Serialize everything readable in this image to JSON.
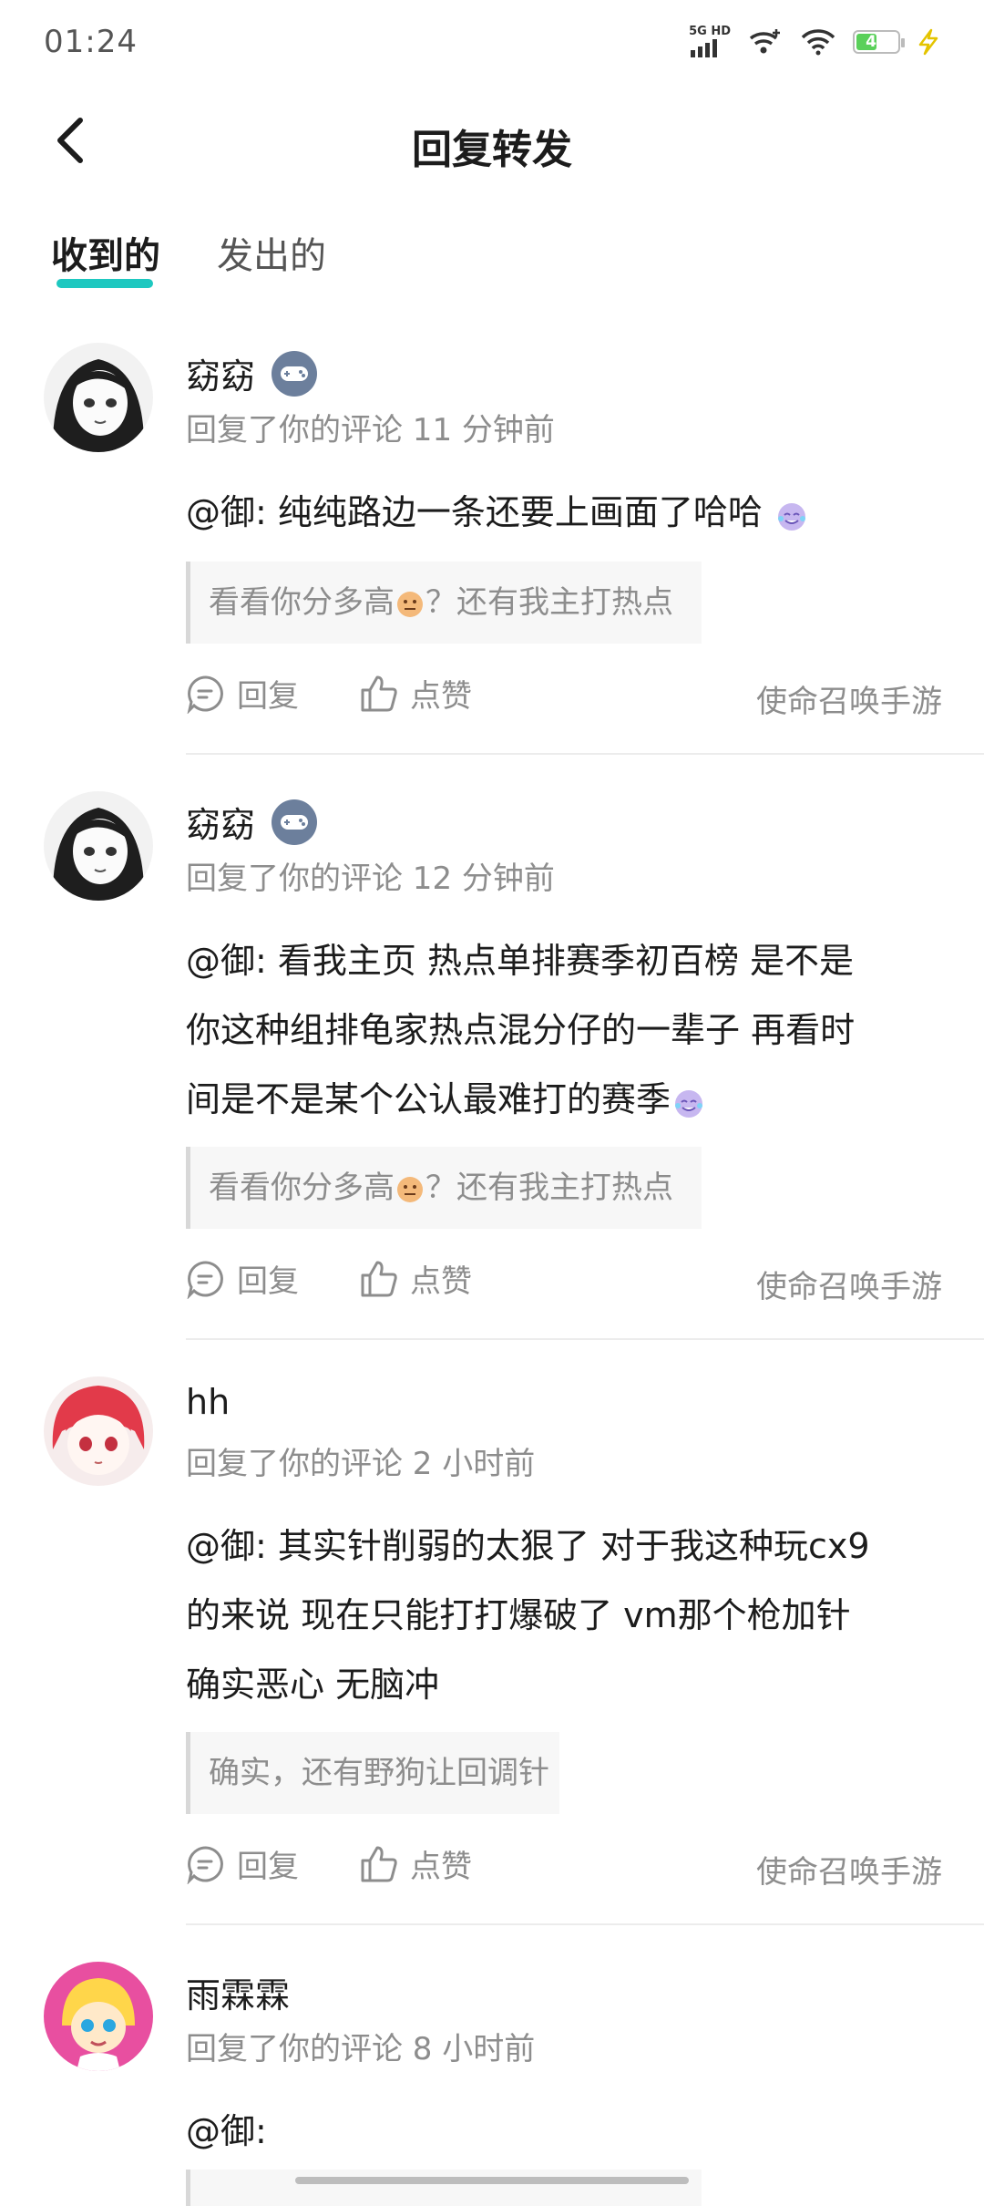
{
  "status_bar": {
    "time": "01:24",
    "network": "5G HD",
    "battery": "45"
  },
  "header": {
    "title": "回复转发"
  },
  "tabs": [
    {
      "label": "收到的"
    },
    {
      "label": "发出的"
    }
  ],
  "comments": [
    {
      "username": "窈窈",
      "meta": "回复了你的评论 11 分钟前",
      "text": "@御: 纯纯路边一条还要上画面了哈哈",
      "quote_a": "看看你分多高",
      "quote_b": "？还有我主打热点",
      "game": "使命召唤手游"
    },
    {
      "username": "窈窈",
      "meta": "回复了你的评论 12 分钟前",
      "text_line1": "@御: 看我主页 热点单排赛季初百榜 是不是",
      "text_line2": "你这种组排龟家热点混分仔的一辈子 再看时",
      "text_line3": "间是不是某个公认最难打的赛季",
      "quote_a": "看看你分多高",
      "quote_b": "？还有我主打热点",
      "game": "使命召唤手游"
    },
    {
      "username": "hh",
      "meta": "回复了你的评论 2 小时前",
      "text_line1": "@御: 其实针削弱的太狠了 对于我这种玩cx9",
      "text_line2": "的来说 现在只能打打爆破了 vm那个枪加针",
      "text_line3": "确实恶心 无脑冲",
      "quote": "确实，还有野狗让回调针",
      "game": "使命召唤手游"
    },
    {
      "username": "雨霖霖",
      "meta": "回复了你的评论 8 小时前",
      "text": "@御:"
    }
  ],
  "actions": {
    "reply": "回复",
    "like": "点赞"
  },
  "colors": {
    "accent": "#1ec8c0",
    "badge": "#6c7f9c",
    "muted": "#8d8d8d"
  },
  "icons": [
    "back-arrow-icon",
    "game-controller-icon",
    "reply-bubble-icon",
    "thumbs-up-icon",
    "signal-icon",
    "wifi-icon",
    "battery-icon",
    "charging-bolt-icon"
  ]
}
